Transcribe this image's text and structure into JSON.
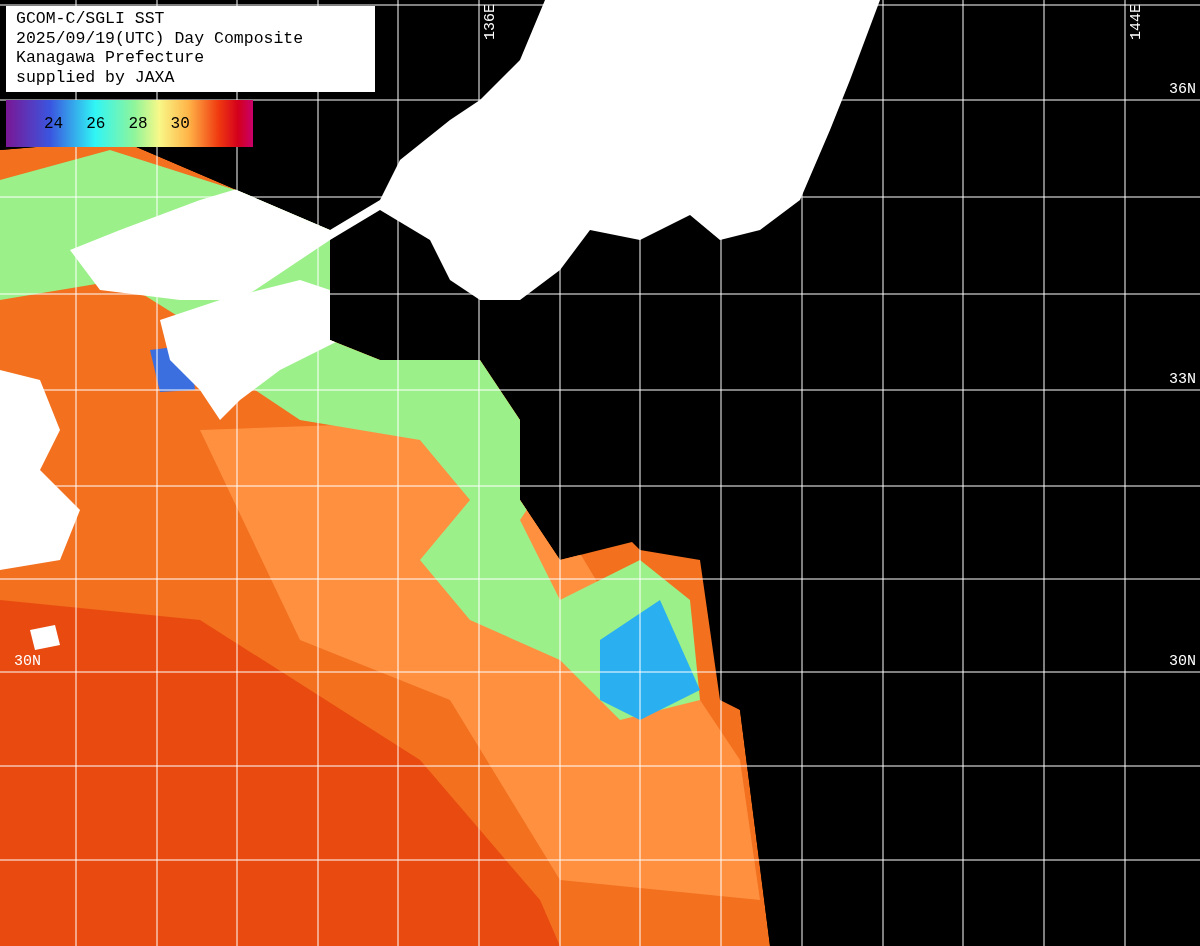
{
  "title_box": {
    "lines": [
      "GCOM-C/SGLI SST",
      "2025/09/19(UTC) Day Composite",
      "Kanagawa Prefecture",
      "supplied by JAXA"
    ]
  },
  "color_scale": {
    "ticks": [
      "24",
      "26",
      "28",
      "30"
    ]
  },
  "longitude_labels": [
    "136E",
    "144E"
  ],
  "latitude_labels": [
    "36N",
    "33N",
    "30N",
    "30N"
  ]
}
